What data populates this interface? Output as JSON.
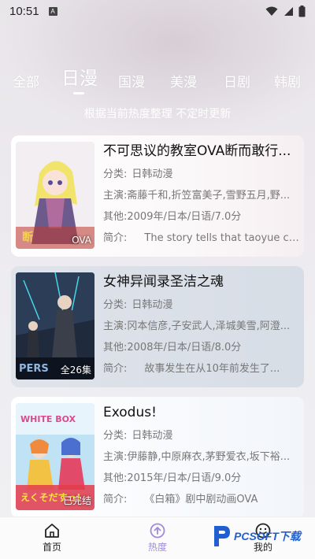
{
  "status": {
    "time": "10:51"
  },
  "tabs": [
    {
      "label": "全部"
    },
    {
      "label": "日漫"
    },
    {
      "label": "国漫"
    },
    {
      "label": "美漫"
    },
    {
      "label": "日剧"
    },
    {
      "label": "韩剧"
    }
  ],
  "active_tab": "日漫",
  "subtitle": "根据当前热度整理 不定时更新",
  "items": [
    {
      "title": "不可思议的教室OVA断而敢行...",
      "category_label": "分类:",
      "category": "日韩动漫",
      "cast_label": "主演:",
      "cast": "斋藤千和,折笠富美子,雪野五月,野...",
      "other_label": "其他:",
      "other": "2009年/日本/日语/7.0分",
      "intro_label": "简介:",
      "intro": "The story tells that taoyue co...",
      "badge": "OVA"
    },
    {
      "title": "女神异闻录圣洁之魂",
      "category_label": "分类:",
      "category": "日韩动漫",
      "cast_label": "主演:",
      "cast": "冈本信彦,子安武人,泽城美雪,阿澄...",
      "other_label": "其他:",
      "other": "2008年/日本/日语/8.0分",
      "intro_label": "简介:",
      "intro": "故事发生在从10年前发生了...",
      "badge": "全26集"
    },
    {
      "title": "Exodus!",
      "category_label": "分类:",
      "category": "日韩动漫",
      "cast_label": "主演:",
      "cast": "伊藤静,中原麻衣,茅野爱衣,坂下裕...",
      "other_label": "其他:",
      "other": "2015年/日本/日语/9.0分",
      "intro_label": "简介:",
      "intro": "《白箱》剧中剧动画OVA",
      "badge": "已完结"
    }
  ],
  "nav": [
    {
      "label": "首页",
      "icon": "home-icon"
    },
    {
      "label": "热度",
      "icon": "hot-icon"
    },
    {
      "label": "我的",
      "icon": "profile-icon"
    }
  ],
  "watermark": {
    "text": "PCSOFT下载"
  },
  "colors": {
    "accent": "#a08bd6",
    "tab_text": "#ffffff"
  }
}
